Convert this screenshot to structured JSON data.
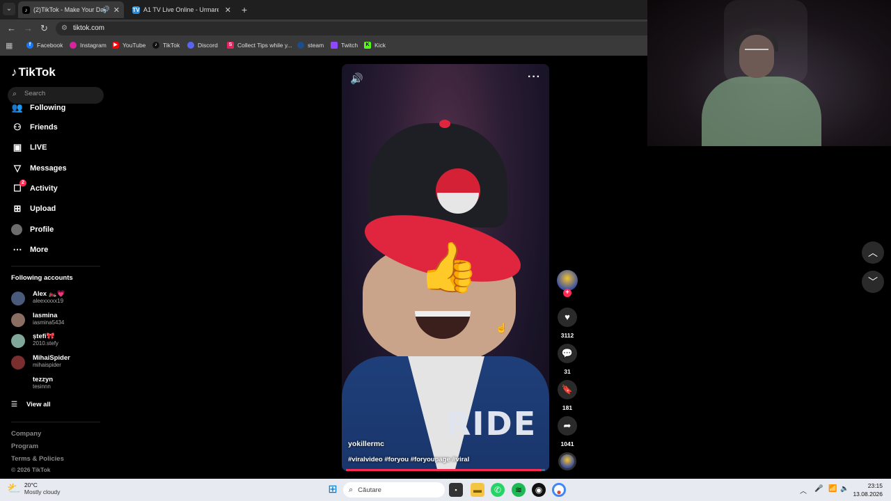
{
  "browser": {
    "tabs": [
      {
        "title": "(2)TikTok - Make Your Day",
        "active": true
      },
      {
        "title": "A1 TV Live Online - Urmareste",
        "active": false
      }
    ],
    "url": "tiktok.com",
    "bookmarks": [
      {
        "label": "Facebook",
        "color": "#1877f2"
      },
      {
        "label": "Instagram",
        "color": "#d6249f"
      },
      {
        "label": "YouTube",
        "color": "#ff0000"
      },
      {
        "label": "TikTok",
        "color": "#111111"
      },
      {
        "label": "Discord",
        "color": "#5865f2"
      },
      {
        "label": "Collect Tips while y...",
        "color": "#e0245e"
      },
      {
        "label": "steam",
        "color": "#1b4d8a"
      },
      {
        "label": "Twitch",
        "color": "#9146ff"
      },
      {
        "label": "Kick",
        "color": "#53fc18"
      }
    ]
  },
  "sidebar": {
    "logo": "TikTok",
    "search_placeholder": "Search",
    "nav": [
      {
        "label": "Following",
        "icon": "following-icon"
      },
      {
        "label": "Friends",
        "icon": "friends-icon"
      },
      {
        "label": "LIVE",
        "icon": "live-icon"
      },
      {
        "label": "Messages",
        "icon": "messages-icon"
      },
      {
        "label": "Activity",
        "icon": "activity-icon",
        "badge": "2"
      },
      {
        "label": "Upload",
        "icon": "upload-icon"
      },
      {
        "label": "Profile",
        "icon": "profile-avatar"
      },
      {
        "label": "More",
        "icon": "more-icon"
      }
    ],
    "following_title": "Following accounts",
    "accounts": [
      {
        "name": "Alex 🏍️💗",
        "username": "aleexxxxx19",
        "color": "#4a5a7a"
      },
      {
        "name": "Iasmina",
        "username": "iasmina5434",
        "color": "#8a6e63"
      },
      {
        "name": "ștefi🎀",
        "username": "2010.stefy",
        "color": "#7fa89a"
      },
      {
        "name": "MihaiSpider",
        "username": "mihaispider",
        "color": "#7a2e2e"
      },
      {
        "name": "tezzyn",
        "username": "tesinnn",
        "color": "#000000"
      }
    ],
    "view_all": "View all",
    "footer": [
      "Company",
      "Program",
      "Terms & Policies"
    ],
    "copyright": "© 2026 TikTok"
  },
  "video": {
    "author": "yokillermc",
    "hashtags": "#viralvideo #foryou #foryoupage #viral",
    "jacket_text": "RIDE",
    "progress": 0.98,
    "accent": "#fe2c55"
  },
  "actions": {
    "likes": "3112",
    "comments": "31",
    "saves": "181",
    "shares": "1041"
  },
  "taskbar": {
    "temp": "20°C",
    "condition": "Mostly cloudy",
    "search": "Căutare",
    "time": "23:15",
    "date": "13.08.2026"
  }
}
